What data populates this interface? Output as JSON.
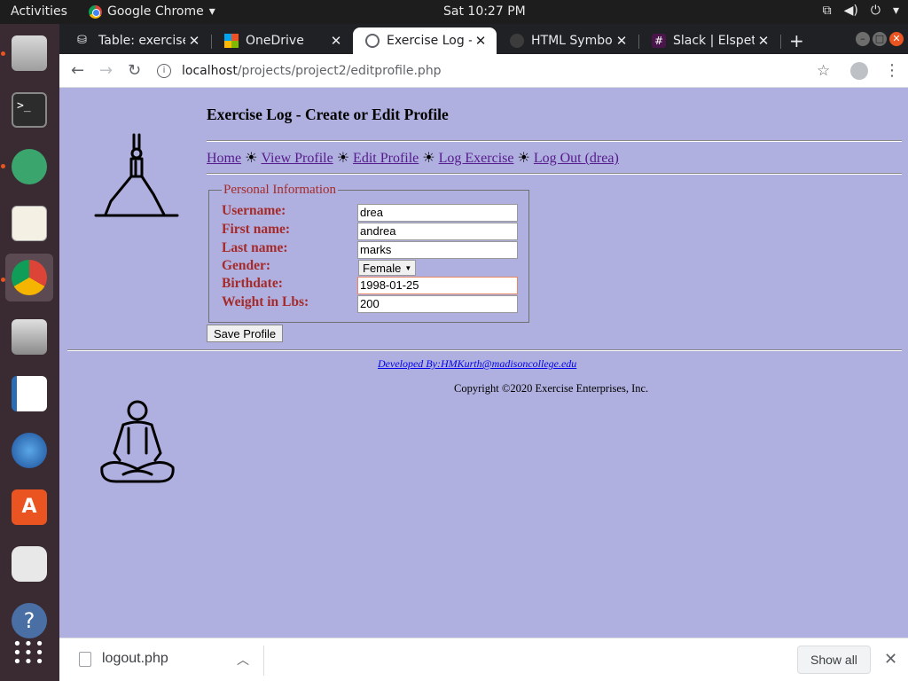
{
  "system": {
    "activities": "Activities",
    "app_name": "Google Chrome",
    "clock": "Sat 10:27 PM"
  },
  "dock": {
    "items": [
      "files-icon",
      "terminal-icon",
      "atom-icon",
      "text-editor-icon",
      "chrome-icon",
      "camera-icon",
      "writer-icon",
      "thunderbird-icon",
      "software-center-icon",
      "rhythmbox-icon",
      "help-icon",
      "app-grid-icon"
    ]
  },
  "browser": {
    "tabs": [
      {
        "title": "Table: exercise",
        "favicon": "database-icon"
      },
      {
        "title": "OneDrive",
        "favicon": "microsoft-icon"
      },
      {
        "title": "Exercise Log -",
        "favicon": "globe-icon"
      },
      {
        "title": "HTML Symbol",
        "favicon": "github-icon"
      },
      {
        "title": "Slack | Elspeth",
        "favicon": "slack-icon"
      }
    ],
    "active_tab": 2,
    "url_host": "localhost",
    "url_path": "/projects/project2/editprofile.php"
  },
  "page": {
    "heading": "Exercise Log - Create or Edit Profile",
    "nav": {
      "home": "Home",
      "view_profile": "View Profile",
      "edit_profile": "Edit Profile",
      "log_exercise": "Log Exercise",
      "log_out": "Log Out (drea)",
      "separator": "☀"
    },
    "form": {
      "legend": "Personal Information",
      "username_label": "Username:",
      "username_value": "drea",
      "first_name_label": "First name:",
      "first_name_value": "andrea",
      "last_name_label": "Last name:",
      "last_name_value": "marks",
      "gender_label": "Gender:",
      "gender_value": "Female",
      "birthdate_label": "Birthdate:",
      "birthdate_value": "1998-01-25",
      "weight_label": "Weight in Lbs:",
      "weight_value": "200",
      "save_label": "Save Profile"
    },
    "footer": {
      "developer_link": "Developed By:HMKurth@madisoncollege.edu",
      "copyright": "Copyright ©2020 Exercise Enterprises, Inc."
    }
  },
  "downloads": {
    "file": "logout.php",
    "show_all": "Show all"
  },
  "colors": {
    "page_bg": "#b0b0e0",
    "label": "#a52a2a",
    "link_visited": "#551a8b",
    "link": "#0000ee"
  }
}
